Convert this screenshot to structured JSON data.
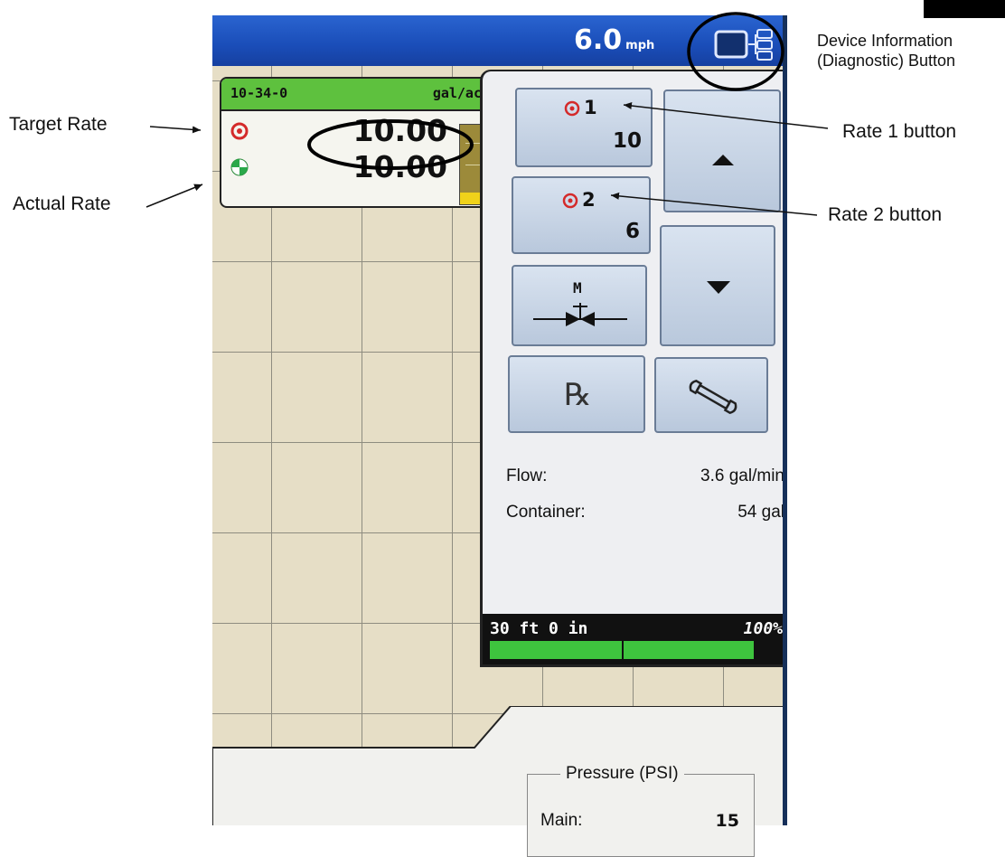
{
  "status_bar": {
    "speed_value": "6.0",
    "speed_unit": "mph"
  },
  "product": {
    "name": "10-34-0",
    "unit": "gal/ac",
    "target_rate": "10.00",
    "actual_rate": "10.00",
    "level_fraction": 0.15
  },
  "rate_buttons": {
    "rate1_number": "1",
    "rate1_value": "10",
    "rate2_number": "2",
    "rate2_value": "6"
  },
  "manual_button": {
    "label": "M"
  },
  "info": {
    "flow_label": "Flow:",
    "flow_value": "3.6 gal/min",
    "container_label": "Container:",
    "container_value": "54 gal"
  },
  "implement": {
    "width": "30 ft 0 in",
    "percent": "100%"
  },
  "pressure": {
    "title": "Pressure (PSI)",
    "main_label": "Main:",
    "main_value": "15"
  },
  "annotations": {
    "target_rate": "Target Rate",
    "actual_rate": "Actual Rate",
    "rate1": "Rate 1 button",
    "rate2": "Rate 2 button",
    "device_info_line1": "Device Information",
    "device_info_line2": "(Diagnostic) Button"
  },
  "colors": {
    "topbar": "#1a4db8",
    "product_bar": "#5ec13e",
    "section_bar": "#3ec43e",
    "target_icon": "#d42a2a",
    "level_fill": "#f0d21a"
  }
}
